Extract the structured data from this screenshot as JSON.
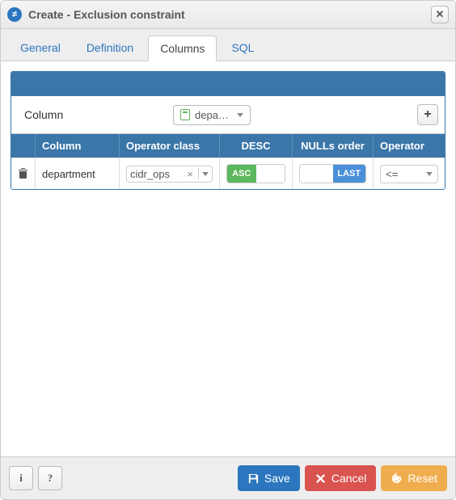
{
  "title": "Create - Exclusion constraint",
  "tabs": [
    "General",
    "Definition",
    "Columns",
    "SQL"
  ],
  "active_tab": 2,
  "form": {
    "column_label": "Column",
    "column_value": "depa…"
  },
  "grid": {
    "headers": [
      "Column",
      "Operator class",
      "DESC",
      "NULLs order",
      "Operator"
    ],
    "rows": [
      {
        "column": "department",
        "operator_class": "cidr_ops",
        "desc_left": "ASC",
        "nulls_right": "LAST",
        "operator": "<="
      }
    ]
  },
  "footer": {
    "save": "Save",
    "cancel": "Cancel",
    "reset": "Reset"
  }
}
